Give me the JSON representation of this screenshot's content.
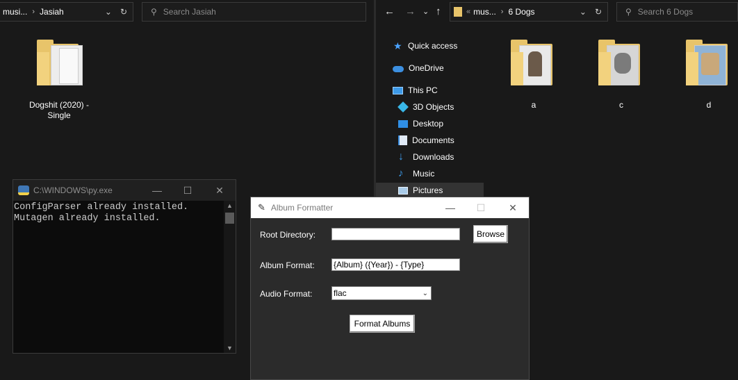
{
  "left_explorer": {
    "breadcrumb": [
      "musi...",
      "Jasiah"
    ],
    "search_placeholder": "Search Jasiah",
    "items": [
      {
        "name": "Dogshit (2020) - Single"
      }
    ]
  },
  "right_explorer": {
    "breadcrumb": [
      "mus...",
      "6 Dogs"
    ],
    "search_placeholder": "Search 6 Dogs",
    "nav": {
      "quick_access": "Quick access",
      "onedrive": "OneDrive",
      "this_pc": "This PC",
      "objects_3d": "3D Objects",
      "desktop": "Desktop",
      "documents": "Documents",
      "downloads": "Downloads",
      "music": "Music",
      "pictures": "Pictures"
    },
    "folders": [
      {
        "name": "a"
      },
      {
        "name": "c"
      },
      {
        "name": "d"
      }
    ]
  },
  "console": {
    "title": "C:\\WINDOWS\\py.exe",
    "lines": [
      "ConfigParser already installed.",
      "Mutagen already installed."
    ]
  },
  "app": {
    "title": "Album Formatter",
    "root_label": "Root Directory:",
    "root_value": "",
    "browse_label": "Browse",
    "album_format_label": "Album Format:",
    "album_format_value": "{Album} ({Year}) - {Type}",
    "audio_format_label": "Audio Format:",
    "audio_format_value": "flac",
    "format_button": "Format Albums"
  },
  "colors": {
    "folder": "#e8c46a",
    "background": "#191919",
    "accent": "#4aa3ff"
  }
}
